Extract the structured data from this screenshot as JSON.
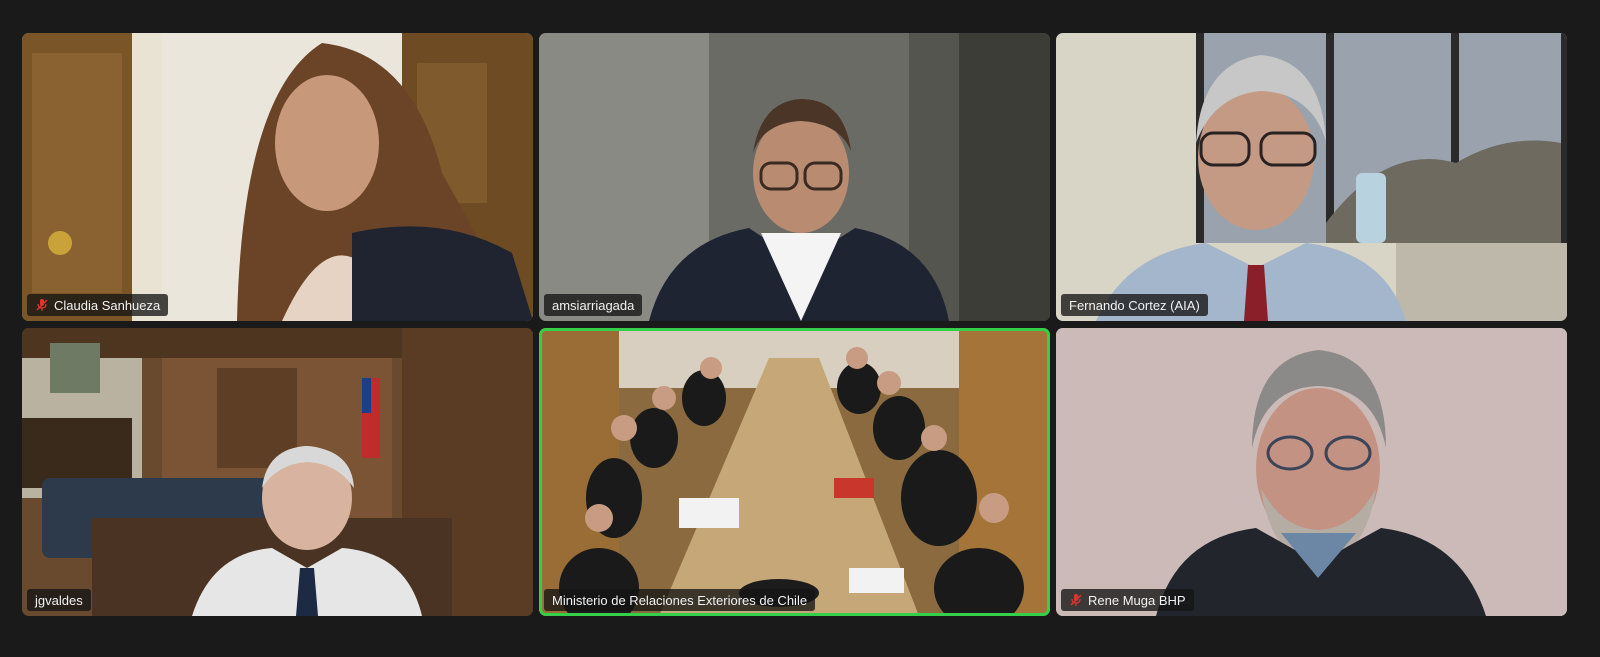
{
  "participants": [
    {
      "name": "Claudia Sanhueza",
      "muted": true
    },
    {
      "name": "amsiarriagada",
      "muted": false
    },
    {
      "name": "Fernando Cortez (AIA)",
      "muted": false
    },
    {
      "name": "jgvaldes",
      "muted": false
    },
    {
      "name": "Ministerio de Relaciones Exteriores de Chile",
      "muted": false,
      "active_speaker": true
    },
    {
      "name": "Rene Muga BHP",
      "muted": true
    }
  ],
  "colors": {
    "background": "#1a1a1a",
    "active_border": "#35d04a",
    "mute_red": "#e0342f",
    "label_bg": "#141414"
  },
  "icons": {
    "muted": "microphone-off-icon"
  }
}
